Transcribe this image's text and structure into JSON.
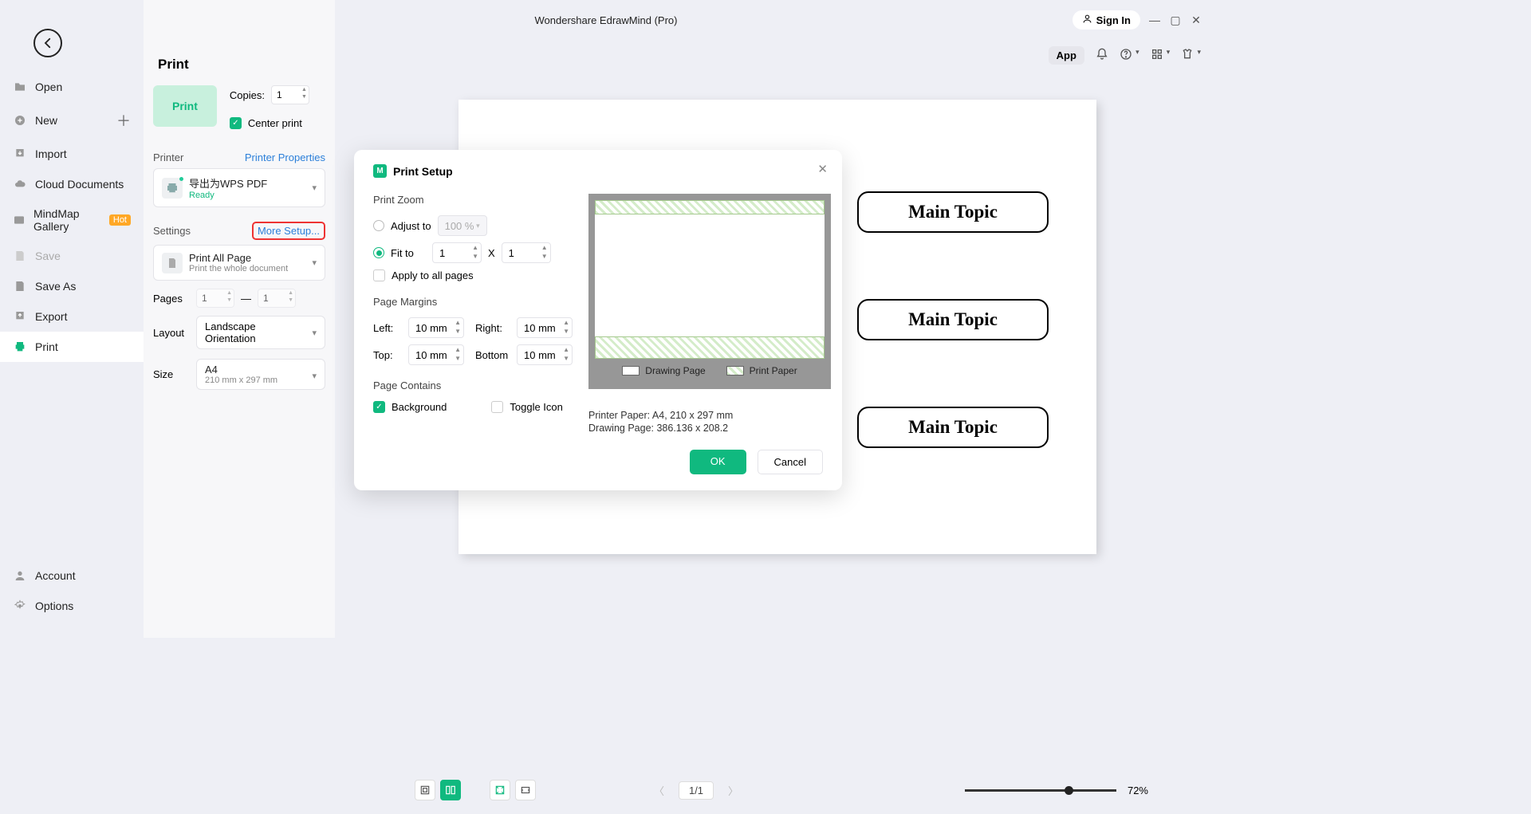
{
  "titlebar": {
    "title": "Wondershare EdrawMind (Pro)",
    "signin": "Sign In"
  },
  "toptools": {
    "app": "App"
  },
  "sidebar": {
    "items": [
      {
        "label": "Open"
      },
      {
        "label": "New"
      },
      {
        "label": "Import"
      },
      {
        "label": "Cloud Documents"
      },
      {
        "label": "MindMap Gallery",
        "hot": "Hot"
      },
      {
        "label": "Save"
      },
      {
        "label": "Save As"
      },
      {
        "label": "Export"
      },
      {
        "label": "Print"
      }
    ],
    "bottom": [
      {
        "label": "Account"
      },
      {
        "label": "Options"
      }
    ]
  },
  "printpanel": {
    "heading": "Print",
    "printbtn": "Print",
    "copies_label": "Copies:",
    "copies_value": "1",
    "center_print": "Center print",
    "printer_label": "Printer",
    "printer_props": "Printer Properties",
    "printer_name": "导出为WPS PDF",
    "printer_status": "Ready",
    "settings_label": "Settings",
    "more_setup": "More Setup...",
    "print_all": "Print All Page",
    "print_all_sub": "Print the whole document",
    "pages_label": "Pages",
    "pages_from": "1",
    "pages_to": "1",
    "layout_label": "Layout",
    "layout_value": "Landscape Orientation",
    "size_label": "Size",
    "size_value": "A4",
    "size_sub": "210 mm x 297 mm"
  },
  "preview": {
    "topics": [
      "Main Topic",
      "Main Topic",
      "Main Topic"
    ]
  },
  "modal": {
    "title": "Print Setup",
    "zoom": {
      "heading": "Print Zoom",
      "adjust_label": "Adjust to",
      "adjust_value": "100 %",
      "fit_label": "Fit to",
      "fit_a": "1",
      "x": "X",
      "fit_b": "1",
      "apply_all": "Apply to all pages"
    },
    "margins": {
      "heading": "Page Margins",
      "left_label": "Left:",
      "left_value": "10 mm",
      "right_label": "Right:",
      "right_value": "10 mm",
      "top_label": "Top:",
      "top_value": "10 mm",
      "bottom_label": "Bottom",
      "bottom_value": "10 mm"
    },
    "contains": {
      "heading": "Page Contains",
      "bg": "Background",
      "toggle": "Toggle Icon"
    },
    "legend": {
      "drawing": "Drawing Page",
      "paper": "Print Paper"
    },
    "info1": "Printer Paper: A4, 210 x 297 mm",
    "info2": "Drawing Page: 386.136 x 208.2",
    "ok": "OK",
    "cancel": "Cancel"
  },
  "bottombar": {
    "page": "1/1",
    "zoom": "72%"
  }
}
